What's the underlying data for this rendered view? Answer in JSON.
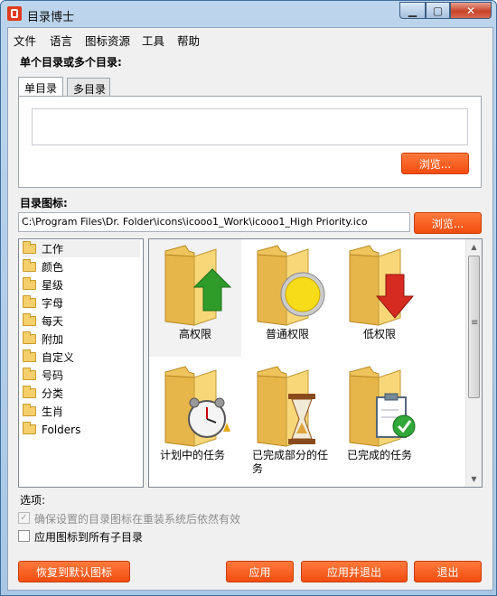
{
  "window": {
    "title": "目录博士"
  },
  "menu": [
    "文件",
    "语言",
    "图标资源",
    "工具",
    "帮助"
  ],
  "single_or_multi_label": "单个目录或多个目录:",
  "tabs": [
    {
      "label": "单目录"
    },
    {
      "label": "多目录"
    }
  ],
  "browse_dir_label": "浏览...",
  "dir_icon_label": "目录图标:",
  "icon_path": "C:\\Program Files\\Dr. Folder\\icons\\icooo1_Work\\icooo1_High Priority.ico",
  "browse_icon_label": "浏览...",
  "categories": [
    "工作",
    "颜色",
    "星级",
    "字母",
    "每天",
    "附加",
    "自定义",
    "号码",
    "分类",
    "生肖",
    "Folders"
  ],
  "icons": [
    {
      "label": "高权限",
      "icon": "folder-up-arrow-icon"
    },
    {
      "label": "普通权限",
      "icon": "folder-circle-icon"
    },
    {
      "label": "低权限",
      "icon": "folder-down-arrow-icon"
    },
    {
      "label": "计划中的任务",
      "icon": "folder-alarm-clock-icon"
    },
    {
      "label": "已完成部分的任务",
      "icon": "folder-hourglass-icon"
    },
    {
      "label": "已完成的任务",
      "icon": "folder-clipboard-check-icon"
    }
  ],
  "options_label": "选项:",
  "option1": "确保设置的目录图标在重装系统后依然有效",
  "option2": "应用图标到所有子目录",
  "buttons": {
    "restore": "恢复到默认图标",
    "apply": "应用",
    "apply_exit": "应用并退出",
    "exit": "退出"
  },
  "colors": {
    "accent": "#f24d0f",
    "folder": "#f5cf6b"
  }
}
